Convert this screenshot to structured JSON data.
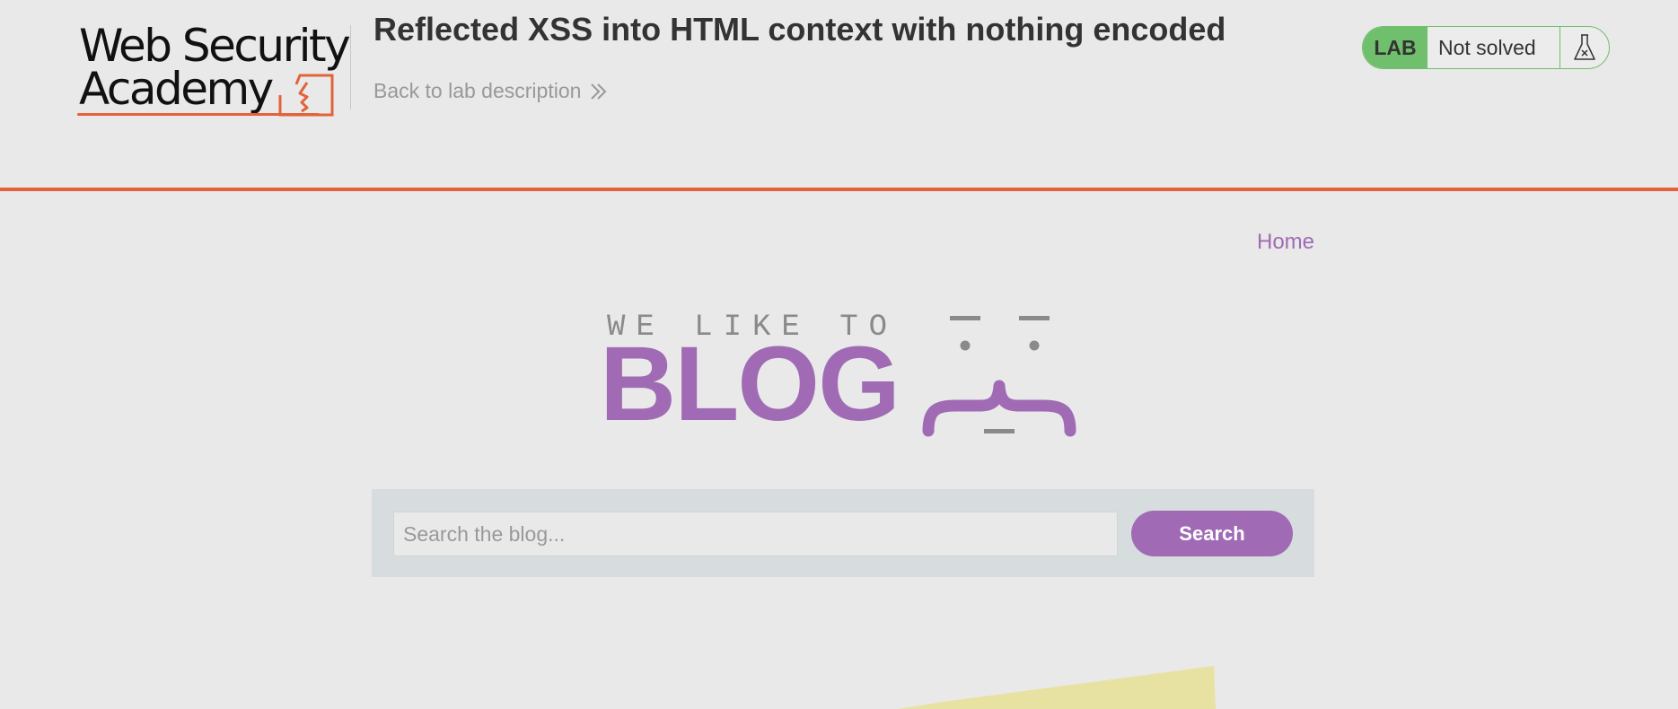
{
  "header": {
    "logo_line1": "Web Security",
    "logo_line2": "Academy",
    "lab_title": "Reflected XSS into HTML context with nothing encoded",
    "back_link": "Back to lab description",
    "status": {
      "badge": "LAB",
      "text": "Not solved",
      "icon": "flask-icon"
    }
  },
  "nav": {
    "home": "Home"
  },
  "banner": {
    "small_text": "WE LIKE TO",
    "big_text": "BLOG"
  },
  "search": {
    "placeholder": "Search the blog...",
    "value": "",
    "button_label": "Search"
  },
  "colors": {
    "accent_orange": "#e2633b",
    "accent_purple": "#a06bb4",
    "status_green": "#70bf6c",
    "background": "#e9e9e9",
    "search_panel": "#d7dcde"
  }
}
